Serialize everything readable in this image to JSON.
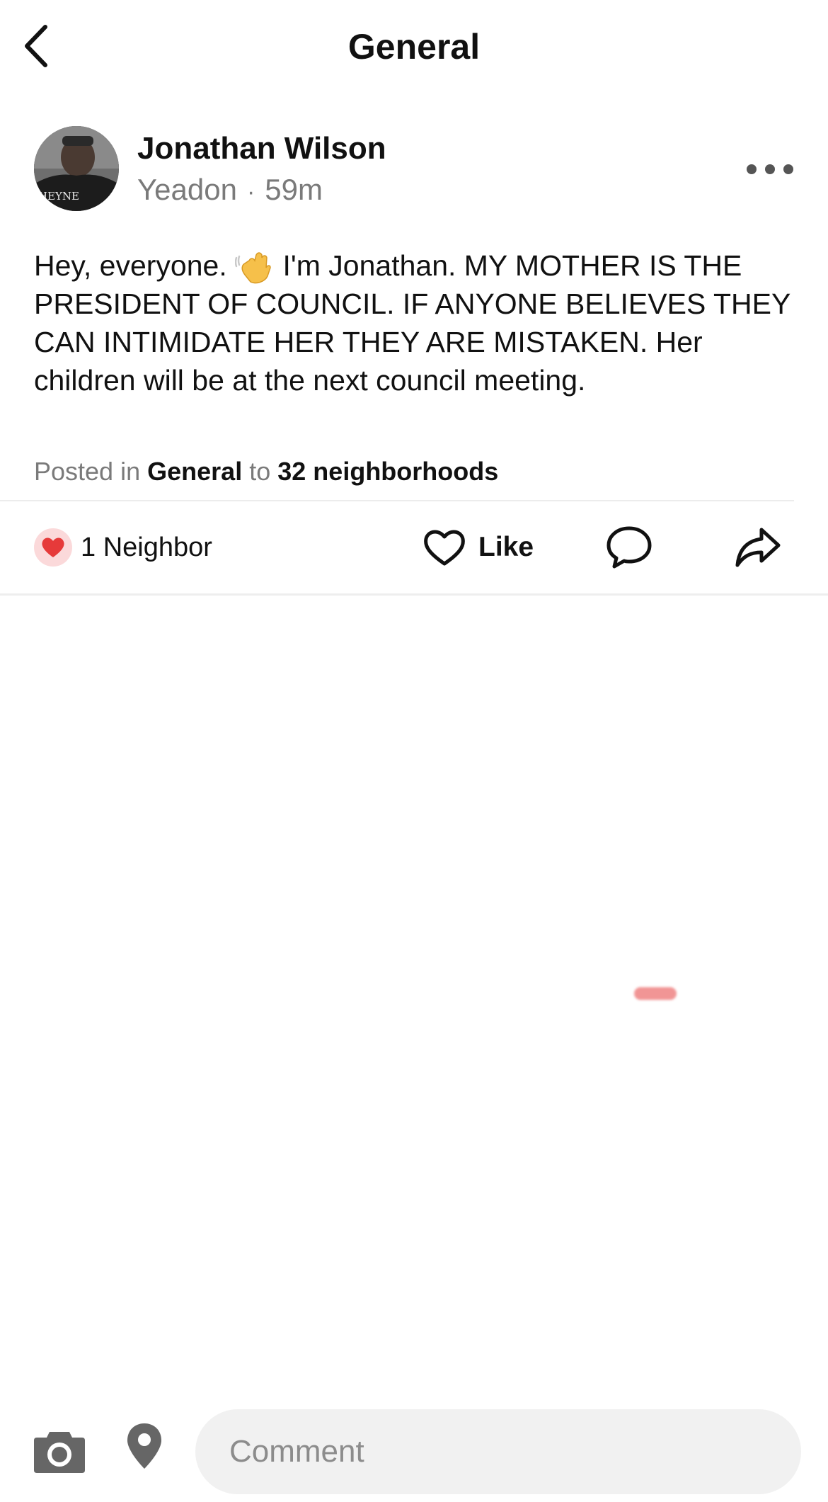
{
  "header": {
    "title": "General"
  },
  "post": {
    "author": {
      "name": "Jonathan Wilson",
      "location": "Yeadon",
      "separator": "·",
      "time_ago": "59m",
      "avatar_shirt_text": "HEYNE"
    },
    "body_before_emoji": "Hey, everyone.",
    "body_after_emoji": "I'm Jonathan. MY MOTHER IS THE PRESIDENT OF COUNCIL. IF ANYONE BELIEVES THEY CAN INTIMIDATE HER THEY ARE MISTAKEN. Her children will be at the next council meeting.",
    "emoji": "waving-hand-icon",
    "posted_in": {
      "prefix": "Posted in",
      "category": "General",
      "connector": "to",
      "audience": "32 neighborhoods"
    }
  },
  "actions": {
    "reaction_count_label": "1 Neighbor",
    "like_label": "Like"
  },
  "composer": {
    "placeholder": "Comment"
  },
  "colors": {
    "text_primary": "#111111",
    "text_secondary": "#7a7a7a",
    "heart_red": "#e63a3a",
    "heart_badge_bg": "#fbd9da",
    "icon_gray": "#666666",
    "input_bg": "#f1f1f1"
  }
}
